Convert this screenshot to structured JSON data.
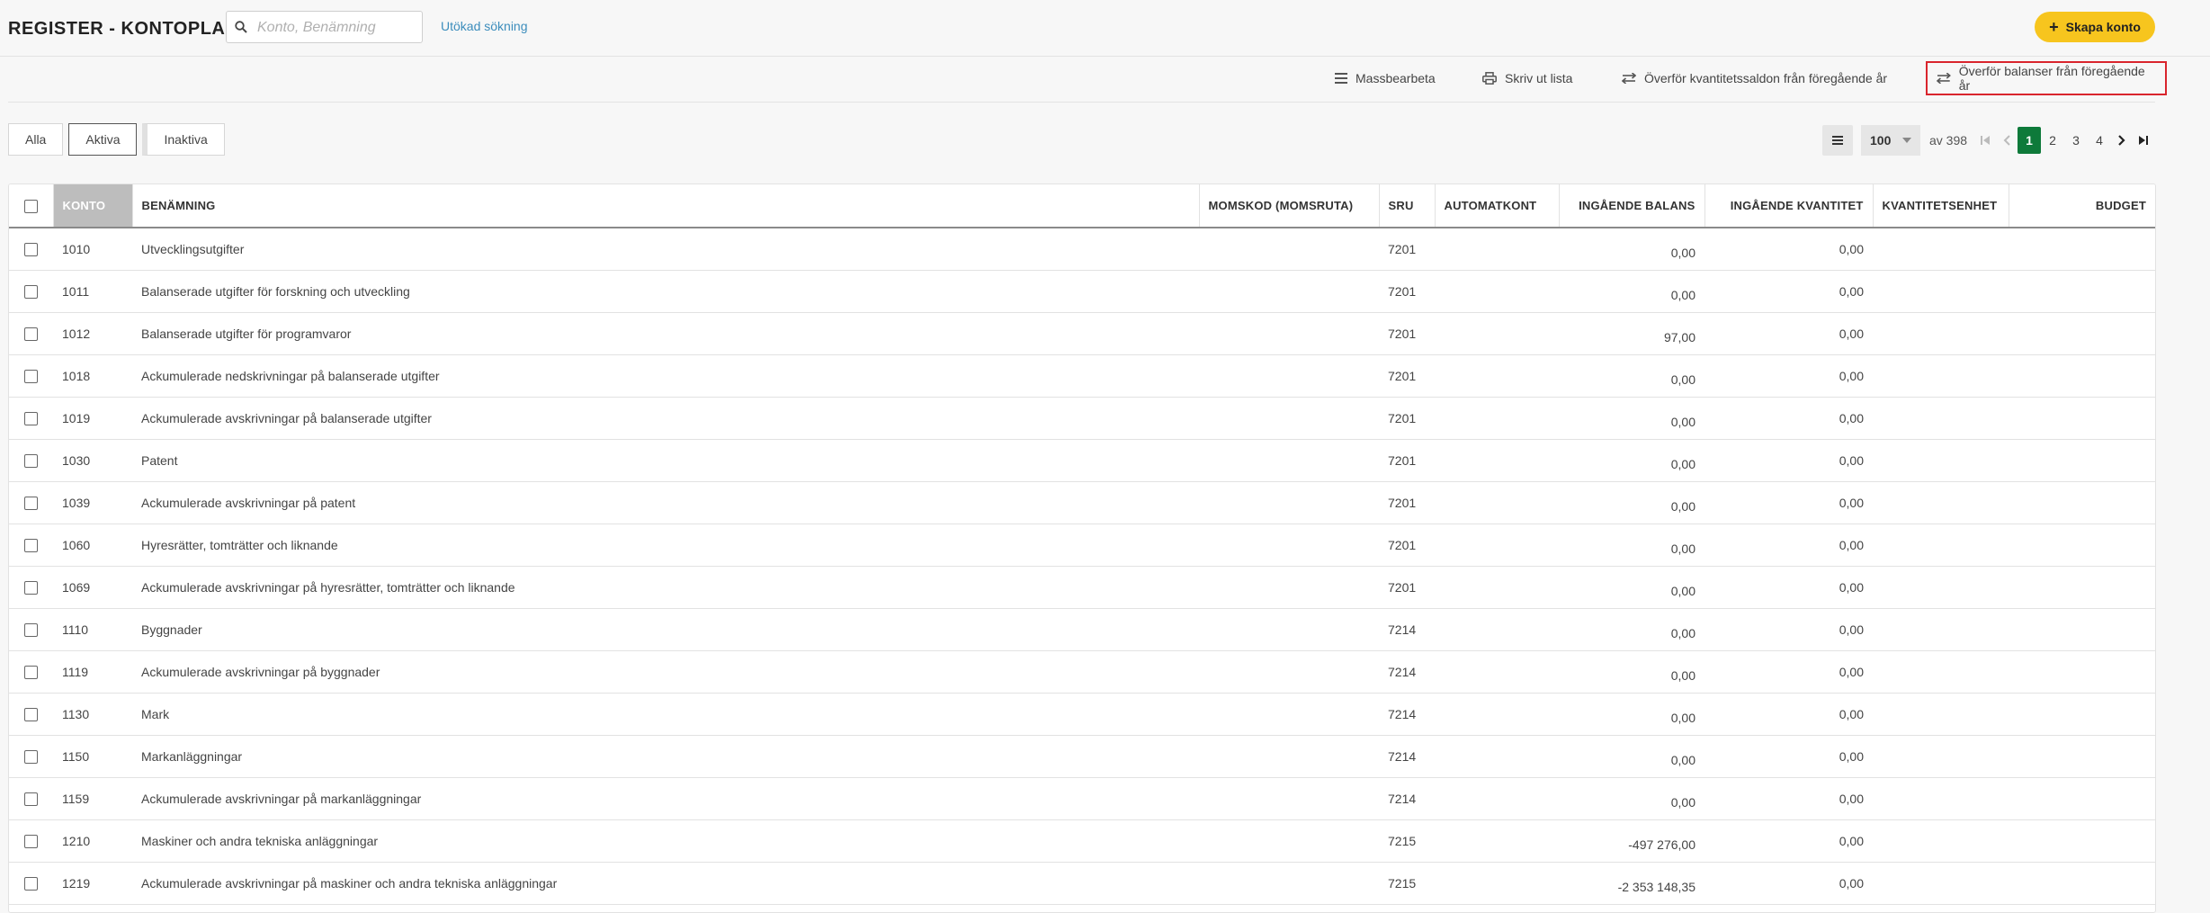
{
  "header": {
    "title": "REGISTER - KONTOPLAN",
    "search_placeholder": "Konto, Benämning",
    "advanced_search": "Utökad sökning",
    "create_button": "Skapa konto",
    "colors": {
      "create_button": "#f7c51e",
      "link": "#3c8dbc",
      "highlight_border": "#d9252d"
    }
  },
  "toolbar": {
    "mass_edit": "Massbearbeta",
    "print_list": "Skriv ut lista",
    "transfer_quantity": "Överför kvantitetssaldon från föregående år",
    "transfer_balances": "Överför balanser från föregående år"
  },
  "filters": {
    "all": "Alla",
    "active": "Aktiva",
    "inactive": "Inaktiva",
    "selected": "Aktiva"
  },
  "pagination": {
    "page_size": "100",
    "total": "av 398",
    "pages": [
      "1",
      "2",
      "3",
      "4"
    ],
    "current_page": "1",
    "colors": {
      "current": "#0e7a3a"
    }
  },
  "table": {
    "columns": {
      "konto": "KONTO",
      "benamning": "BENÄMNING",
      "momskod": "MOMSKOD (MOMSRUTA)",
      "sru": "SRU",
      "automatkont": "AUTOMATKONT",
      "ingaende_balans": "INGÅENDE BALANS",
      "ingaende_kvantitet": "INGÅENDE KVANTITET",
      "kvantitetsenhet": "KVANTITETSENHET",
      "budget": "BUDGET"
    },
    "sorted_column": "KONTO",
    "rows": [
      {
        "konto": "1010",
        "benamning": "Utvecklingsutgifter",
        "momskod": "",
        "sru": "7201",
        "automatkont": "",
        "balans": "0,00",
        "kvantitet": "0,00",
        "enhet": "",
        "budget": ""
      },
      {
        "konto": "1011",
        "benamning": "Balanserade utgifter för forskning och utveckling",
        "momskod": "",
        "sru": "7201",
        "automatkont": "",
        "balans": "0,00",
        "kvantitet": "0,00",
        "enhet": "",
        "budget": ""
      },
      {
        "konto": "1012",
        "benamning": "Balanserade utgifter för programvaror",
        "momskod": "",
        "sru": "7201",
        "automatkont": "",
        "balans": "97,00",
        "kvantitet": "0,00",
        "enhet": "",
        "budget": ""
      },
      {
        "konto": "1018",
        "benamning": "Ackumulerade nedskrivningar på balanserade utgifter",
        "momskod": "",
        "sru": "7201",
        "automatkont": "",
        "balans": "0,00",
        "kvantitet": "0,00",
        "enhet": "",
        "budget": ""
      },
      {
        "konto": "1019",
        "benamning": "Ackumulerade avskrivningar på balanserade utgifter",
        "momskod": "",
        "sru": "7201",
        "automatkont": "",
        "balans": "0,00",
        "kvantitet": "0,00",
        "enhet": "",
        "budget": ""
      },
      {
        "konto": "1030",
        "benamning": "Patent",
        "momskod": "",
        "sru": "7201",
        "automatkont": "",
        "balans": "0,00",
        "kvantitet": "0,00",
        "enhet": "",
        "budget": ""
      },
      {
        "konto": "1039",
        "benamning": "Ackumulerade avskrivningar på patent",
        "momskod": "",
        "sru": "7201",
        "automatkont": "",
        "balans": "0,00",
        "kvantitet": "0,00",
        "enhet": "",
        "budget": ""
      },
      {
        "konto": "1060",
        "benamning": "Hyresrätter, tomträtter och liknande",
        "momskod": "",
        "sru": "7201",
        "automatkont": "",
        "balans": "0,00",
        "kvantitet": "0,00",
        "enhet": "",
        "budget": ""
      },
      {
        "konto": "1069",
        "benamning": "Ackumulerade avskrivningar på hyresrätter, tomträtter och liknande",
        "momskod": "",
        "sru": "7201",
        "automatkont": "",
        "balans": "0,00",
        "kvantitet": "0,00",
        "enhet": "",
        "budget": ""
      },
      {
        "konto": "1110",
        "benamning": "Byggnader",
        "momskod": "",
        "sru": "7214",
        "automatkont": "",
        "balans": "0,00",
        "kvantitet": "0,00",
        "enhet": "",
        "budget": ""
      },
      {
        "konto": "1119",
        "benamning": "Ackumulerade avskrivningar på byggnader",
        "momskod": "",
        "sru": "7214",
        "automatkont": "",
        "balans": "0,00",
        "kvantitet": "0,00",
        "enhet": "",
        "budget": ""
      },
      {
        "konto": "1130",
        "benamning": "Mark",
        "momskod": "",
        "sru": "7214",
        "automatkont": "",
        "balans": "0,00",
        "kvantitet": "0,00",
        "enhet": "",
        "budget": ""
      },
      {
        "konto": "1150",
        "benamning": "Markanläggningar",
        "momskod": "",
        "sru": "7214",
        "automatkont": "",
        "balans": "0,00",
        "kvantitet": "0,00",
        "enhet": "",
        "budget": ""
      },
      {
        "konto": "1159",
        "benamning": "Ackumulerade avskrivningar på markanläggningar",
        "momskod": "",
        "sru": "7214",
        "automatkont": "",
        "balans": "0,00",
        "kvantitet": "0,00",
        "enhet": "",
        "budget": ""
      },
      {
        "konto": "1210",
        "benamning": "Maskiner och andra tekniska anläggningar",
        "momskod": "",
        "sru": "7215",
        "automatkont": "",
        "balans": "-497 276,00",
        "kvantitet": "0,00",
        "enhet": "",
        "budget": ""
      },
      {
        "konto": "1219",
        "benamning": "Ackumulerade avskrivningar på maskiner och andra tekniska anläggningar",
        "momskod": "",
        "sru": "7215",
        "automatkont": "",
        "balans": "-2 353 148,35",
        "kvantitet": "0,00",
        "enhet": "",
        "budget": ""
      }
    ]
  }
}
